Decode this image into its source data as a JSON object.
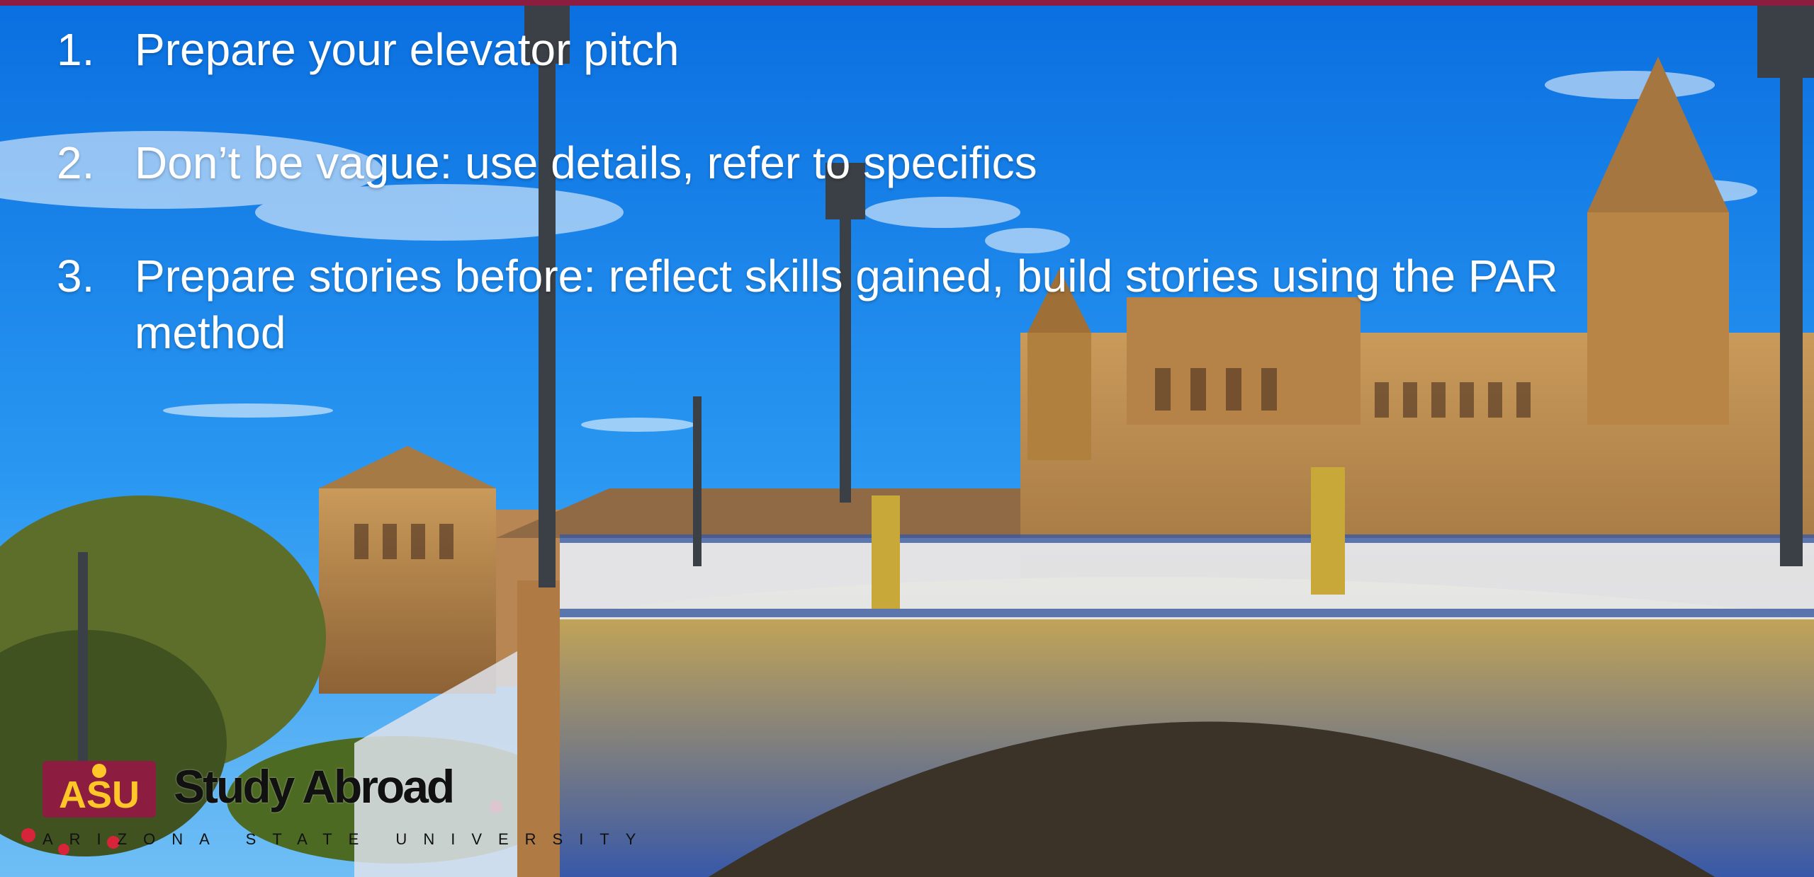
{
  "slide": {
    "accent_color": "#8c1d40",
    "background_description_icon": "plaza-de-espana-bridge-photo",
    "bullets": [
      {
        "number": "1.",
        "text": "Prepare your elevator pitch"
      },
      {
        "number": "2.",
        "text": "Don’t be vague: use details, refer to specifics"
      },
      {
        "number": "3.",
        "text": "Prepare stories before: reflect skills gained, build stories using the PAR method"
      }
    ]
  },
  "logo": {
    "mark_text": "ASU",
    "title": "Study Abroad",
    "subtitle": "ARIZONA STATE UNIVERSITY",
    "mark_color": "#8c1d40",
    "accent_color": "#ffc627"
  }
}
